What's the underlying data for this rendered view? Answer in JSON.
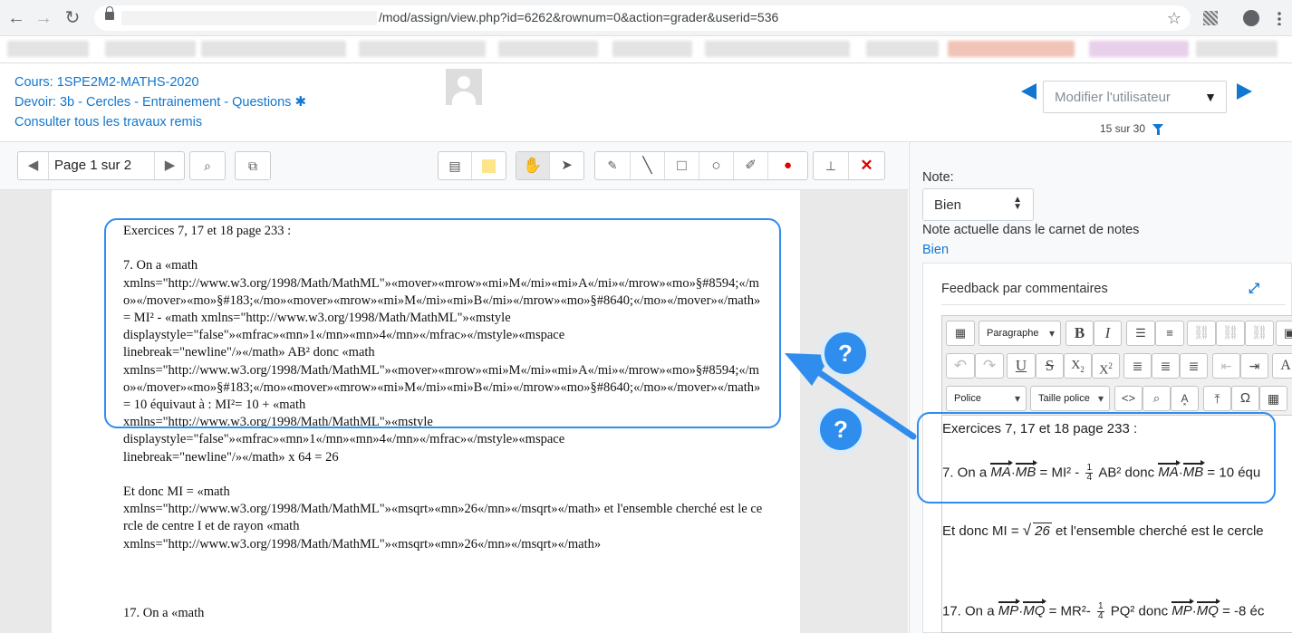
{
  "browser": {
    "url_suffix": "/mod/assign/view.php?id=6262&rownum=0&action=grader&userid=536",
    "back_icon": "←",
    "forward_icon": "→",
    "reload_icon": "↻",
    "star_icon": "☆"
  },
  "header": {
    "course": "Cours: 1SPE2M2-MATHS-2020",
    "assignment": "Devoir: 3b - Cercles - Entrainement - Questions",
    "view_all": "Consulter tous les travaux remis",
    "user_select_placeholder": "Modifier l'utilisateur",
    "position_count": "15 sur 30"
  },
  "pdf_toolbar": {
    "page_label": "Page 1 sur 2"
  },
  "document": {
    "lines": [
      "Exercices 7, 17 et 18 page 233 :",
      "",
      "7. On a «math",
      "xmlns=\"http://www.w3.org/1998/Math/MathML\"»«mover»«mrow»«mi»M«/mi»«mi»A«/mi»«/mrow»«mo»§#8594;«/mo»«/mover»«mo»§#183;«/mo»«mover»«mrow»«mi»M«/mi»«mi»B«/mi»«/mrow»«mo»§#8640;«/mo»«/mover»«/math» = MI² - «math xmlns=\"http://www.w3.org/1998/Math/MathML\"»«mstyle",
      "displaystyle=\"false\"»«mfrac»«mn»1«/mn»«mn»4«/mn»«/mfrac»«/mstyle»«mspace",
      "linebreak=\"newline\"/»«/math» AB²  donc «math",
      "xmlns=\"http://www.w3.org/1998/Math/MathML\"»«mover»«mrow»«mi»M«/mi»«mi»A«/mi»«/mrow»«mo»§#8594;«/mo»«/mover»«mo»§#183;«/mo»«mover»«mrow»«mi»M«/mi»«mi»B«/mi»«/mrow»«mo»§#8640;«/mo»«/mover»«/math» = 10 équivaut à : MI²= 10 + «math",
      "xmlns=\"http://www.w3.org/1998/Math/MathML\"»«mstyle",
      "displaystyle=\"false\"»«mfrac»«mn»1«/mn»«mn»4«/mn»«/mfrac»«/mstyle»«mspace",
      "linebreak=\"newline\"/»«/math» x 64 = 26",
      "",
      "Et donc MI = «math",
      "xmlns=\"http://www.w3.org/1998/Math/MathML\"»«msqrt»«mn»26«/mn»«/msqrt»«/math» et l'ensemble cherché est le cercle de centre I et de rayon «math",
      "xmlns=\"http://www.w3.org/1998/Math/MathML\"»«msqrt»«mn»26«/mn»«/msqrt»«/math»",
      "",
      "",
      "",
      "17. On a «math"
    ]
  },
  "grading": {
    "note_label": "Note:",
    "note_value": "Bien",
    "current_label": "Note actuelle dans le carnet de notes",
    "current_value": "Bien",
    "feedback_title": "Feedback par commentaires",
    "paragraph_select": "Paragraphe",
    "font_select": "Police",
    "size_select": "Taille police"
  },
  "editor_content": {
    "line1": "Exercices 7, 17 et 18 page 233 :",
    "l7_prefix": "7. On a",
    "vec_ma": "MA",
    "vec_mb": "MB",
    "l7_mid": "= MI² -",
    "frac_num": "1",
    "frac_den": "4",
    "l7_ab": "AB²  donc",
    "l7_end": "= 10 équ",
    "et_prefix": "Et donc MI =",
    "sqrt_val": "26",
    "et_suffix": "et l'ensemble cherché est le cercle",
    "l17_prefix": "17. On a",
    "vec_mp": "MP",
    "vec_mq": "MQ",
    "l17_mid": "= MR²-",
    "l17_pq": "PQ² donc",
    "l17_end": "= -8 éc"
  },
  "annotations": {
    "help_icon": "?"
  },
  "colors": {
    "link": "#1177d1",
    "highlight": "#2f8ded",
    "annotation_delete": "#e00000",
    "annotation_color": "#fde68a"
  }
}
